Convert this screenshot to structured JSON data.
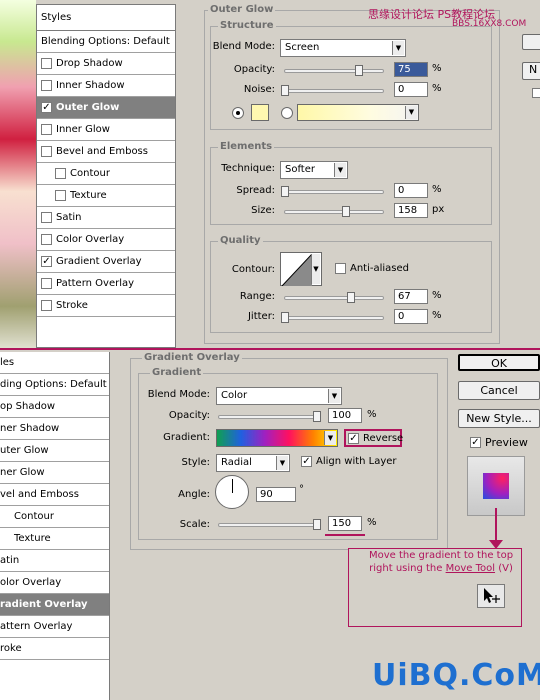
{
  "watermark_top": "思缘设计论坛 PS教程论坛",
  "watermark_top2": "BBS.16XX8.COM",
  "top": {
    "styles_header": "Styles",
    "styles_list": [
      {
        "label": "Blending Options: Default",
        "check": null,
        "sel": false,
        "indent": false
      },
      {
        "label": "Drop Shadow",
        "check": false,
        "sel": false,
        "indent": false
      },
      {
        "label": "Inner Shadow",
        "check": false,
        "sel": false,
        "indent": false
      },
      {
        "label": "Outer Glow",
        "check": true,
        "sel": true,
        "indent": false
      },
      {
        "label": "Inner Glow",
        "check": false,
        "sel": false,
        "indent": false
      },
      {
        "label": "Bevel and Emboss",
        "check": false,
        "sel": false,
        "indent": false
      },
      {
        "label": "Contour",
        "check": false,
        "sel": false,
        "indent": true
      },
      {
        "label": "Texture",
        "check": false,
        "sel": false,
        "indent": true
      },
      {
        "label": "Satin",
        "check": false,
        "sel": false,
        "indent": false
      },
      {
        "label": "Color Overlay",
        "check": false,
        "sel": false,
        "indent": false
      },
      {
        "label": "Gradient Overlay",
        "check": true,
        "sel": false,
        "indent": false
      },
      {
        "label": "Pattern Overlay",
        "check": false,
        "sel": false,
        "indent": false
      },
      {
        "label": "Stroke",
        "check": false,
        "sel": false,
        "indent": false
      }
    ],
    "outer_glow_title": "Outer Glow",
    "structure_title": "Structure",
    "blend_mode_label": "Blend Mode:",
    "blend_mode_value": "Screen",
    "opacity_label": "Opacity:",
    "opacity_value": "75",
    "opacity_pct": 75,
    "noise_label": "Noise:",
    "noise_value": "0",
    "noise_pct": 0,
    "glow_color": "#fff8b0",
    "elements_title": "Elements",
    "technique_label": "Technique:",
    "technique_value": "Softer",
    "spread_label": "Spread:",
    "spread_value": "0",
    "spread_pct": 0,
    "size_label": "Size:",
    "size_value": "158",
    "size_unit": "px",
    "size_pct": 62,
    "quality_title": "Quality",
    "contour_label": "Contour:",
    "anti_aliased_label": "Anti-aliased",
    "anti_aliased": false,
    "range_label": "Range:",
    "range_value": "67",
    "range_pct": 67,
    "jitter_label": "Jitter:",
    "jitter_value": "0",
    "jitter_pct": 0,
    "right_btn_n": "N",
    "percent": "%"
  },
  "bottom": {
    "styles_list": [
      {
        "label": "les",
        "sel": false,
        "indent": false,
        "check": null
      },
      {
        "label": "ding Options: Default",
        "sel": false,
        "indent": false,
        "check": null
      },
      {
        "label": "op Shadow",
        "sel": false,
        "indent": false,
        "check": null
      },
      {
        "label": "ner Shadow",
        "sel": false,
        "indent": false,
        "check": null
      },
      {
        "label": "uter Glow",
        "sel": false,
        "indent": false,
        "check": null
      },
      {
        "label": "ner Glow",
        "sel": false,
        "indent": false,
        "check": null
      },
      {
        "label": "vel and Emboss",
        "sel": false,
        "indent": false,
        "check": null
      },
      {
        "label": "Contour",
        "sel": false,
        "indent": true,
        "check": null
      },
      {
        "label": "Texture",
        "sel": false,
        "indent": true,
        "check": null
      },
      {
        "label": "atin",
        "sel": false,
        "indent": false,
        "check": null
      },
      {
        "label": "olor Overlay",
        "sel": false,
        "indent": false,
        "check": null
      },
      {
        "label": "radient Overlay",
        "sel": true,
        "indent": false,
        "check": null
      },
      {
        "label": "attern Overlay",
        "sel": false,
        "indent": false,
        "check": null
      },
      {
        "label": "roke",
        "sel": false,
        "indent": false,
        "check": null
      }
    ],
    "gradient_overlay_title": "Gradient Overlay",
    "gradient_title": "Gradient",
    "blend_mode_label": "Blend Mode:",
    "blend_mode_value": "Color",
    "opacity_label": "Opacity:",
    "opacity_value": "100",
    "opacity_pct": 100,
    "gradient_label": "Gradient:",
    "reverse_label": "Reverse",
    "reverse": true,
    "style_label": "Style:",
    "style_value": "Radial",
    "align_label": "Align with Layer",
    "align": true,
    "angle_label": "Angle:",
    "angle_value": "90",
    "degree": "°",
    "scale_label": "Scale:",
    "scale_value": "150",
    "scale_pct": 100,
    "ok_label": "OK",
    "cancel_label": "Cancel",
    "new_style_label": "New Style...",
    "preview_label": "Preview",
    "preview": true,
    "callout_text": "Move the gradient to the top right using the ",
    "callout_link": "Move Tool",
    "callout_tail": " (V)",
    "percent": "%"
  },
  "watermark_bottom": "UiBQ.CoM",
  "colors": {
    "accent": "#b0145c",
    "panel": "#d4d0c8",
    "selected": "#808080"
  }
}
